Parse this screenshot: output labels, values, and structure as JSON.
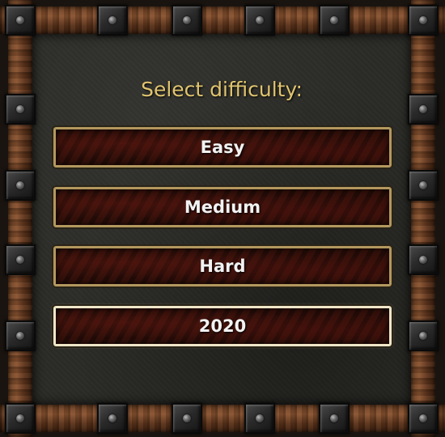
{
  "dialog": {
    "title": "Select difficulty:",
    "options": [
      {
        "label": "Easy",
        "selected": false
      },
      {
        "label": "Medium",
        "selected": false
      },
      {
        "label": "Hard",
        "selected": false
      },
      {
        "label": "2020",
        "selected": true
      }
    ]
  },
  "colors": {
    "title_gold": "#e0c46e",
    "button_border": "#b3985e",
    "button_border_selected": "#efe6c8",
    "button_fill": "#2d0f0a",
    "panel": "#2b2b27",
    "wood": "#6b3f22"
  },
  "decor": {
    "border": "wooden-frame",
    "rivet_icon": "iron-rivet-icon"
  }
}
